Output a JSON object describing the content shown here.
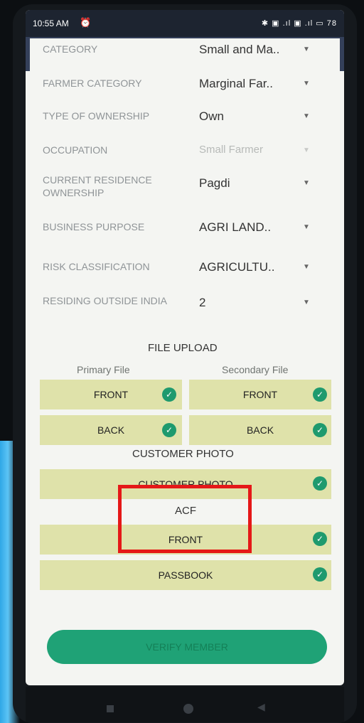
{
  "status": {
    "time": "10:55 AM",
    "alarm_icon": "alarm-icon",
    "icons_text": "✱ ▣ .ıl ▣ .ıl ▭ 78"
  },
  "form_rows": [
    {
      "label": "CATEGORY",
      "value": "Small and Ma..",
      "disabled": false
    },
    {
      "label": "FARMER CATEGORY",
      "value": "Marginal Far..",
      "disabled": false
    },
    {
      "label": "TYPE OF OWNERSHIP",
      "value": "Own",
      "disabled": false
    },
    {
      "label": "OCCUPATION",
      "value": "Small Farmer",
      "disabled": true
    },
    {
      "label": "CURRENT RESIDENCE OWNERSHIP",
      "value": "Pagdi",
      "disabled": false
    },
    {
      "label": "BUSINESS PURPOSE",
      "value": "AGRI LAND..",
      "disabled": false
    },
    {
      "label": "RISK CLASSIFICATION",
      "value": "AGRICULTU..",
      "disabled": false
    },
    {
      "label": "RESIDING OUTSIDE INDIA",
      "value": "2",
      "disabled": false
    }
  ],
  "file_upload": {
    "title": "FILE UPLOAD",
    "primary_label": "Primary File",
    "secondary_label": "Secondary File",
    "primary_front": "FRONT",
    "primary_back": "BACK",
    "secondary_front": "FRONT",
    "secondary_back": "BACK"
  },
  "customer_photo": {
    "title": "CUSTOMER PHOTO",
    "button": "CUSTOMER PHOTO"
  },
  "acf": {
    "title": "ACF",
    "front": "FRONT",
    "passbook": "PASSBOOK"
  },
  "verify_button": "VERIFY MEMBER",
  "colors": {
    "upload_button": "#dfe2aa",
    "check_badge": "#1f9a6e",
    "verify_button": "#1fa276",
    "highlight": "#e51818"
  }
}
